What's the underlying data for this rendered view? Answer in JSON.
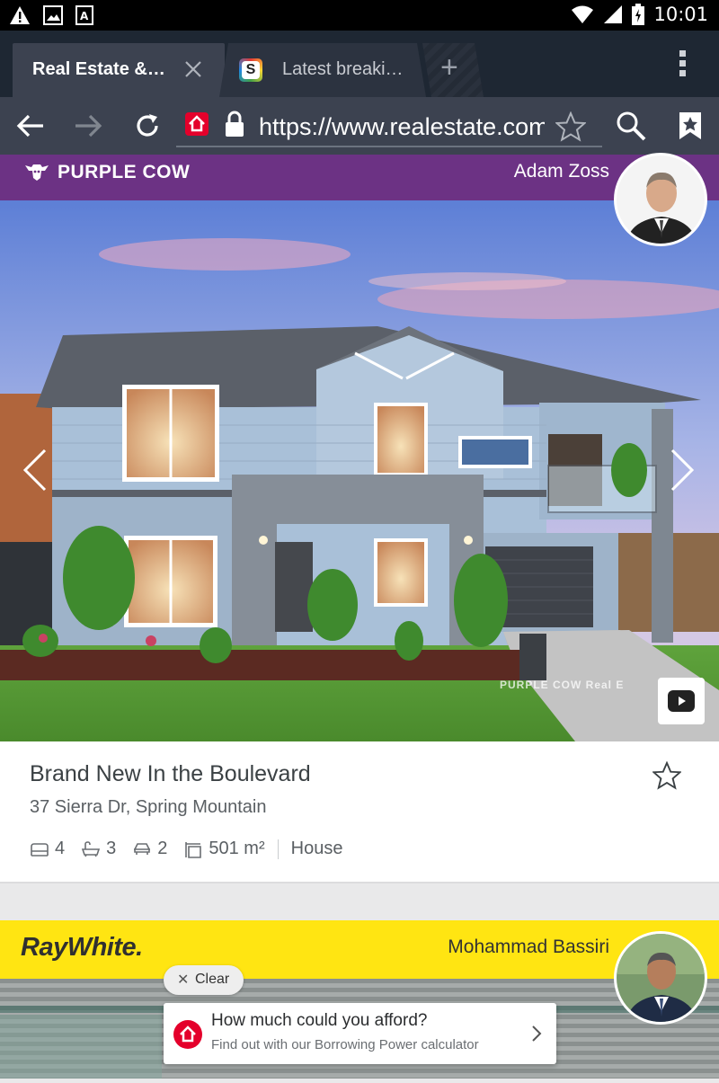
{
  "status_bar": {
    "time": "10:01",
    "icons": [
      "warning-icon",
      "image-icon",
      "a-badge-icon",
      "wifi-icon",
      "signal-icon",
      "battery-icon"
    ]
  },
  "browser": {
    "tabs": [
      {
        "title": "Real Estate &…",
        "active": true
      },
      {
        "title": "Latest breaki…",
        "active": false,
        "favicon_letter": "S"
      }
    ],
    "new_tab_symbol": "+",
    "url": "https://www.realestate.com.au"
  },
  "listing1": {
    "agency": "PURPLE COW",
    "agent": "Adam Zoss",
    "watermark": "PURPLE COW Real E",
    "title": "Brand New In the Boulevard",
    "address": "37 Sierra Dr, Spring Mountain",
    "beds": "4",
    "baths": "3",
    "cars": "2",
    "land": "501 m²",
    "type": "House",
    "brand_color": "#6c3284"
  },
  "listing2": {
    "agency": "RayWhite.",
    "agent": "Mohammad Bassiri",
    "brand_color": "#ffe512"
  },
  "overlay": {
    "clear_label": "Clear",
    "promo_title": "How much could you afford?",
    "promo_subtitle": "Find out with our Borrowing Power calculator"
  }
}
